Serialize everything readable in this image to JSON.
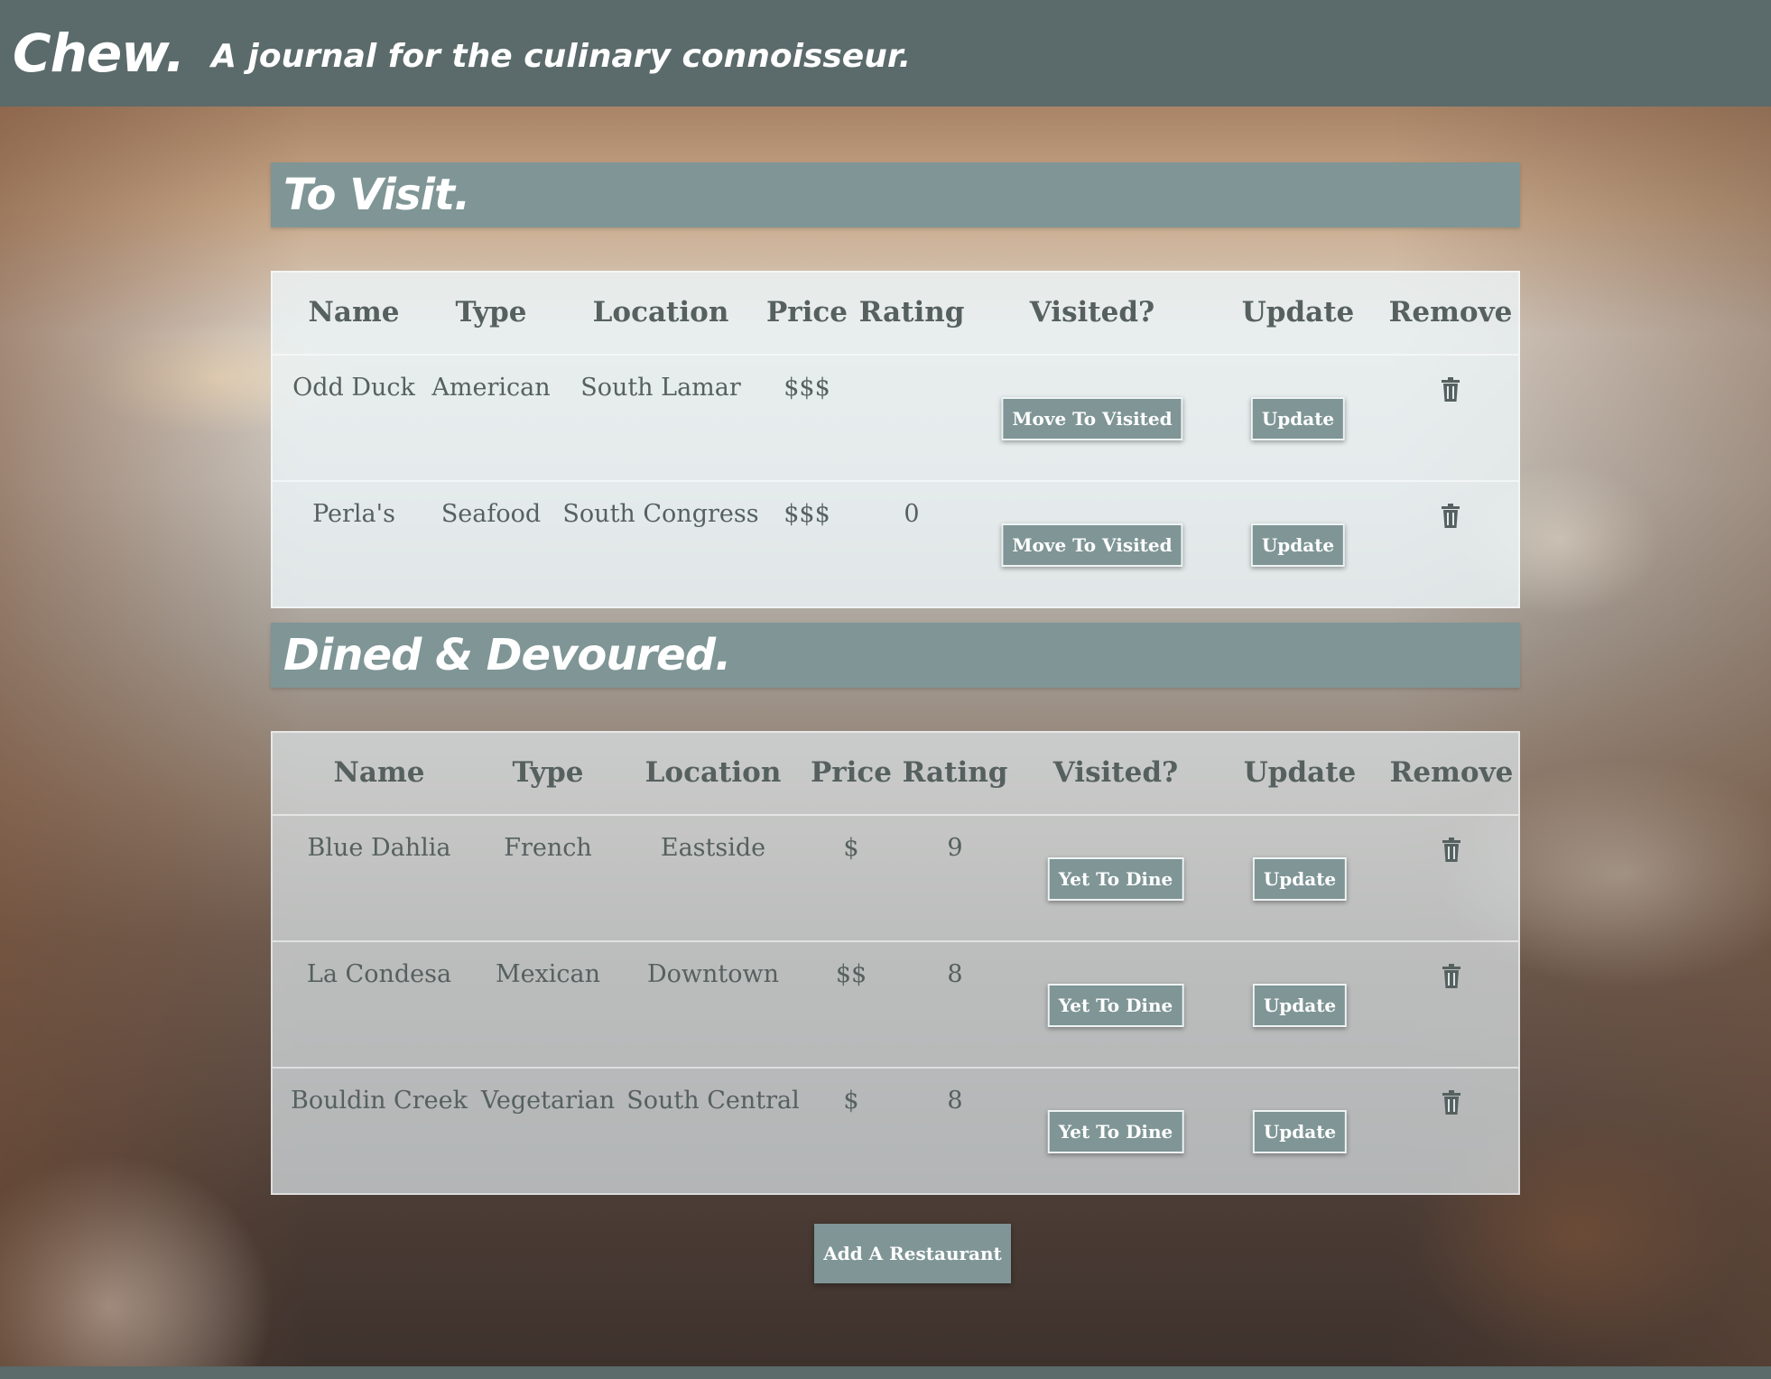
{
  "header": {
    "brand": "Chew.",
    "tagline": "A journal for the culinary connoisseur."
  },
  "to_visit": {
    "title": "To Visit.",
    "columns": [
      "Name",
      "Type",
      "Location",
      "Price",
      "Rating",
      "Visited?",
      "Update",
      "Remove"
    ],
    "rows": [
      {
        "name": "Odd Duck",
        "type": "American",
        "location": "South Lamar",
        "price": "$$$",
        "rating": "",
        "visited_button": "Move To Visited",
        "update_button": "Update",
        "remove_icon": "trash-icon"
      },
      {
        "name": "Perla's",
        "type": "Seafood",
        "location": "South Congress",
        "price": "$$$",
        "rating": "0",
        "visited_button": "Move To Visited",
        "update_button": "Update",
        "remove_icon": "trash-icon"
      }
    ]
  },
  "dined": {
    "title": "Dined & Devoured.",
    "columns": [
      "Name",
      "Type",
      "Location",
      "Price",
      "Rating",
      "Visited?",
      "Update",
      "Remove"
    ],
    "rows": [
      {
        "name": "Blue Dahlia",
        "type": "French",
        "location": "Eastside",
        "price": "$",
        "rating": "9",
        "visited_button": "Yet To Dine",
        "update_button": "Update",
        "remove_icon": "trash-icon"
      },
      {
        "name": "La Condesa",
        "type": "Mexican",
        "location": "Downtown",
        "price": "$$",
        "rating": "8",
        "visited_button": "Yet To Dine",
        "update_button": "Update",
        "remove_icon": "trash-icon"
      },
      {
        "name": "Bouldin Creek",
        "type": "Vegetarian",
        "location": "South Central",
        "price": "$",
        "rating": "8",
        "visited_button": "Yet To Dine",
        "update_button": "Update",
        "remove_icon": "trash-icon"
      }
    ]
  },
  "add_button": "Add A Restaurant",
  "colors": {
    "header_bg": "#5b6a6a",
    "accent": "#7f9596",
    "text": "#56615f"
  }
}
